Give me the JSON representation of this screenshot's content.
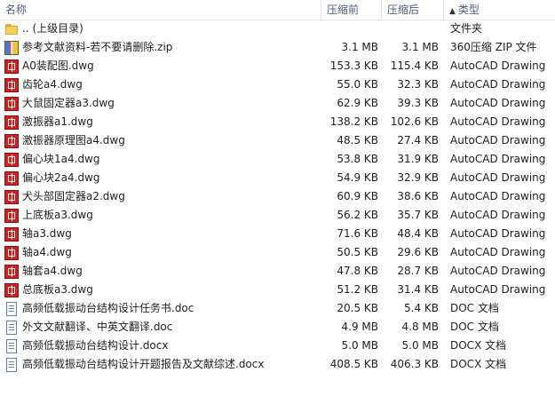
{
  "columns": {
    "name": "名称",
    "compressed": "压缩前",
    "original": "压缩后",
    "type": "类型",
    "sort_indicator": "▲"
  },
  "files": [
    {
      "name": ".. (上级目录)",
      "compressed": "",
      "original": "",
      "type": "文件夹",
      "icon": "folder-icon"
    },
    {
      "name": "参考文献资料-若不要请删除.zip",
      "compressed": "3.1 MB",
      "original": "3.1 MB",
      "type": "360压缩 ZIP 文件",
      "icon": "archive-icon"
    },
    {
      "name": "A0装配图.dwg",
      "compressed": "153.3 KB",
      "original": "115.4 KB",
      "type": "AutoCAD Drawing",
      "icon": "autocad-icon"
    },
    {
      "name": "齿轮a4.dwg",
      "compressed": "55.0 KB",
      "original": "32.3 KB",
      "type": "AutoCAD Drawing",
      "icon": "autocad-icon"
    },
    {
      "name": "大鼠固定器a3.dwg",
      "compressed": "62.9 KB",
      "original": "39.3 KB",
      "type": "AutoCAD Drawing",
      "icon": "autocad-icon"
    },
    {
      "name": "激振器a1.dwg",
      "compressed": "138.2 KB",
      "original": "102.6 KB",
      "type": "AutoCAD Drawing",
      "icon": "autocad-icon"
    },
    {
      "name": "激振器原理图a4.dwg",
      "compressed": "48.5 KB",
      "original": "27.4 KB",
      "type": "AutoCAD Drawing",
      "icon": "autocad-icon"
    },
    {
      "name": "偏心块1a4.dwg",
      "compressed": "53.8 KB",
      "original": "31.9 KB",
      "type": "AutoCAD Drawing",
      "icon": "autocad-icon"
    },
    {
      "name": "偏心块2a4.dwg",
      "compressed": "54.9 KB",
      "original": "32.9 KB",
      "type": "AutoCAD Drawing",
      "icon": "autocad-icon"
    },
    {
      "name": "犬头部固定器a2.dwg",
      "compressed": "60.9 KB",
      "original": "38.6 KB",
      "type": "AutoCAD Drawing",
      "icon": "autocad-icon"
    },
    {
      "name": "上底板a3.dwg",
      "compressed": "56.2 KB",
      "original": "35.7 KB",
      "type": "AutoCAD Drawing",
      "icon": "autocad-icon"
    },
    {
      "name": "轴a3.dwg",
      "compressed": "71.6 KB",
      "original": "48.4 KB",
      "type": "AutoCAD Drawing",
      "icon": "autocad-icon"
    },
    {
      "name": "轴a4.dwg",
      "compressed": "50.5 KB",
      "original": "29.6 KB",
      "type": "AutoCAD Drawing",
      "icon": "autocad-icon"
    },
    {
      "name": "轴套a4.dwg",
      "compressed": "47.8 KB",
      "original": "28.7 KB",
      "type": "AutoCAD Drawing",
      "icon": "autocad-icon"
    },
    {
      "name": "总底板a3.dwg",
      "compressed": "51.2 KB",
      "original": "31.4 KB",
      "type": "AutoCAD Drawing",
      "icon": "autocad-icon"
    },
    {
      "name": "高频低载振动台结构设计任务书.doc",
      "compressed": "20.5 KB",
      "original": "5.4 KB",
      "type": "DOC 文档",
      "icon": "document-icon"
    },
    {
      "name": "外文文献翻译、中英文翻译.doc",
      "compressed": "4.9 MB",
      "original": "4.8 MB",
      "type": "DOC 文档",
      "icon": "document-icon"
    },
    {
      "name": "高频低载振动台结构设计.docx",
      "compressed": "5.0 MB",
      "original": "5.0 MB",
      "type": "DOCX 文档",
      "icon": "document-icon"
    },
    {
      "name": "高频低载振动台结构设计开题报告及文献综述.docx",
      "compressed": "408.5 KB",
      "original": "406.3 KB",
      "type": "DOCX 文档",
      "icon": "document-icon"
    }
  ]
}
